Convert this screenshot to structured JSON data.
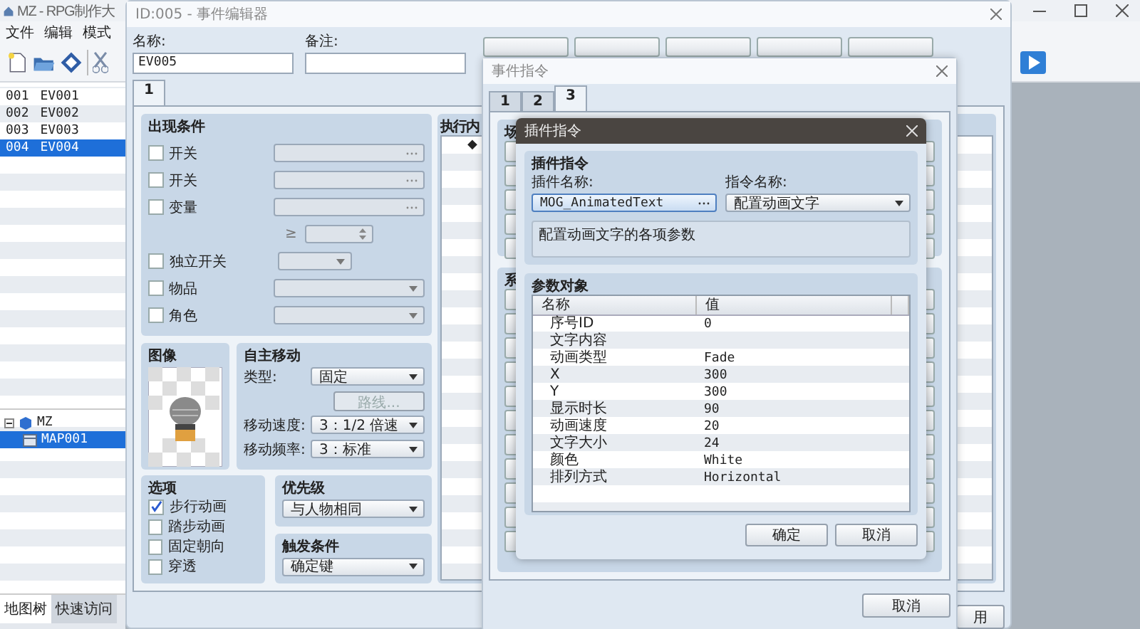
{
  "app": {
    "title": "MZ - RPG制作大",
    "menu": [
      "文件",
      "编辑",
      "模式"
    ],
    "event_list": [
      {
        "id": "001",
        "name": "EV001",
        "selected": false
      },
      {
        "id": "002",
        "name": "EV002",
        "selected": false
      },
      {
        "id": "003",
        "name": "EV003",
        "selected": false
      },
      {
        "id": "004",
        "name": "EV004",
        "selected": true
      }
    ],
    "map_tree": [
      {
        "label": "MZ",
        "expanded": true,
        "selected": false,
        "children": [
          {
            "label": "MAP001",
            "selected": true
          }
        ]
      }
    ],
    "bottom_tabs": [
      {
        "label": "地图树",
        "selected": true
      },
      {
        "label": "快速访问",
        "selected": false
      }
    ]
  },
  "event_editor": {
    "title": "ID:005 - 事件编辑器",
    "name_label": "名称:",
    "name_value": "EV005",
    "note_label": "备注:",
    "page_tabs": [
      {
        "label": "1",
        "selected": true
      }
    ],
    "conditions": {
      "title": "出现条件",
      "rows": [
        {
          "kind": "field",
          "label": "开关",
          "checked": false
        },
        {
          "kind": "field",
          "label": "开关",
          "checked": false
        },
        {
          "kind": "field",
          "label": "变量",
          "checked": false
        },
        {
          "kind": "spinner",
          "label": "≥"
        },
        {
          "kind": "short",
          "label": "独立开关",
          "checked": false
        },
        {
          "kind": "dropdown",
          "label": "物品",
          "checked": false
        },
        {
          "kind": "dropdown",
          "label": "角色",
          "checked": false
        }
      ]
    },
    "image": {
      "title": "图像"
    },
    "movement": {
      "title": "自主移动",
      "type_label": "类型:",
      "type_value": "固定",
      "route_button": "路线...",
      "route_disabled": true,
      "speed_label": "移动速度:",
      "speed_value": "3：1/2 倍速",
      "freq_label": "移动频率:",
      "freq_value": "3：标准"
    },
    "options": {
      "title": "选项",
      "items": [
        {
          "label": "步行动画",
          "checked": true
        },
        {
          "label": "踏步动画",
          "checked": false
        },
        {
          "label": "固定朝向",
          "checked": false
        },
        {
          "label": "穿透",
          "checked": false
        }
      ]
    },
    "priority": {
      "title": "优先级",
      "value": "与人物相同"
    },
    "trigger": {
      "title": "触发条件",
      "value": "确定键"
    },
    "contents": {
      "title": "执行内",
      "first_line": "◆"
    },
    "buttons": [
      {
        "label": "用"
      }
    ]
  },
  "command_window": {
    "title": "事件指令",
    "tabs": [
      {
        "label": "1",
        "selected": false
      },
      {
        "label": "2",
        "selected": false
      },
      {
        "label": "3",
        "selected": true
      }
    ],
    "group_labels": [
      "场",
      "系"
    ],
    "buttons": [
      {
        "label": "取消"
      }
    ]
  },
  "plugin_dialog": {
    "title": "插件指令",
    "group_title": "插件指令",
    "plugin_label": "插件名称:",
    "plugin_value": "MOG_AnimatedText",
    "command_label": "指令名称:",
    "command_value": "配置动画文字",
    "description": "配置动画文字的各项参数",
    "params_title": "参数对象",
    "columns": [
      "名称",
      "值"
    ],
    "rows": [
      {
        "name": "序号ID",
        "value": "0"
      },
      {
        "name": "文字内容"
      },
      {
        "name": "动画类型",
        "value": "Fade"
      },
      {
        "name": "X",
        "value": "300"
      },
      {
        "name": "Y",
        "value": "300"
      },
      {
        "name": "显示时长",
        "value": "90"
      },
      {
        "name": "动画速度",
        "value": "20"
      },
      {
        "name": "文字大小",
        "value": "24"
      },
      {
        "name": "颜色",
        "value": "White"
      },
      {
        "name": "排列方式",
        "value": "Horizontal"
      }
    ],
    "buttons": [
      {
        "label": "确定"
      },
      {
        "label": "取消"
      }
    ]
  }
}
